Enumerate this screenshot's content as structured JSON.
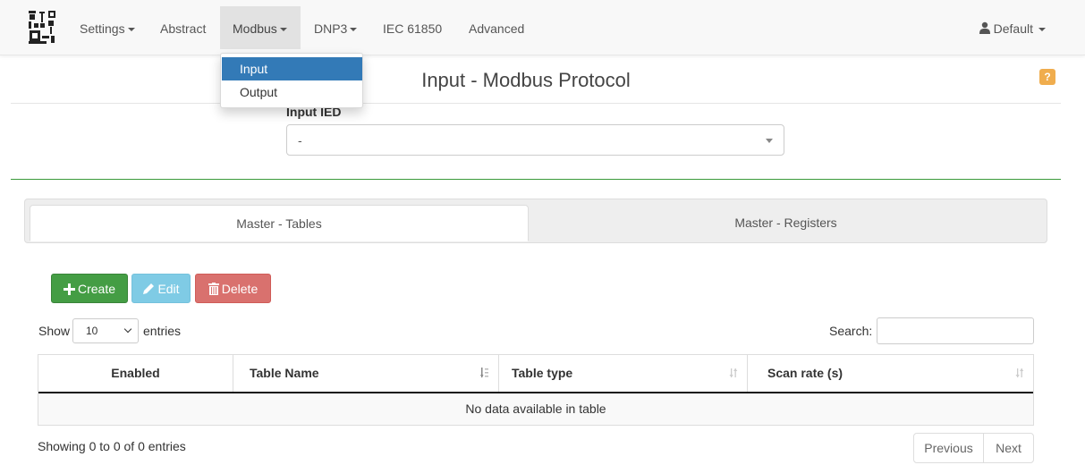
{
  "navbar": {
    "logo_icon": "translator-logo-icon",
    "items": [
      {
        "label": "Settings",
        "has_caret": true
      },
      {
        "label": "Abstract",
        "has_caret": false
      },
      {
        "label": "Modbus",
        "has_caret": true,
        "active": true
      },
      {
        "label": "DNP3",
        "has_caret": true
      },
      {
        "label": "IEC 61850",
        "has_caret": false
      },
      {
        "label": "Advanced",
        "has_caret": false
      }
    ],
    "user": {
      "icon": "user-icon",
      "label": "Default"
    }
  },
  "modbus_menu": {
    "items": [
      {
        "label": "Input",
        "selected": true
      },
      {
        "label": "Output",
        "selected": false
      }
    ]
  },
  "page": {
    "title": "Input - Modbus Protocol",
    "help_icon": "question-icon",
    "help_icon_color": "#f0ad4e"
  },
  "ied": {
    "label": "Input IED",
    "value": "-"
  },
  "tabs": [
    {
      "label": "Master - Tables",
      "active": true
    },
    {
      "label": "Master - Registers",
      "active": false
    }
  ],
  "actions": {
    "create": {
      "label": "Create",
      "icon": "plus-icon",
      "color": "#449d44"
    },
    "edit": {
      "label": "Edit",
      "icon": "pencil-icon",
      "color": "#7fcbe5"
    },
    "delete": {
      "label": "Delete",
      "icon": "trash-icon",
      "color": "#d9716e"
    }
  },
  "table_controls": {
    "show_label": "Show",
    "page_length": "10",
    "entries_label": "entries",
    "search_label": "Search:",
    "search_value": ""
  },
  "table": {
    "columns": [
      {
        "label": "Enabled",
        "sort_icon": ""
      },
      {
        "label": "Table Name",
        "sort_icon": "sort-alpha-asc-icon"
      },
      {
        "label": "Table type",
        "sort_icon": "sort-icon"
      },
      {
        "label": "Scan rate (s)",
        "sort_icon": "sort-icon"
      }
    ],
    "empty_message": "No data available in table"
  },
  "footer": {
    "info": "Showing 0 to 0 of 0 entries",
    "previous": "Previous",
    "next": "Next"
  }
}
